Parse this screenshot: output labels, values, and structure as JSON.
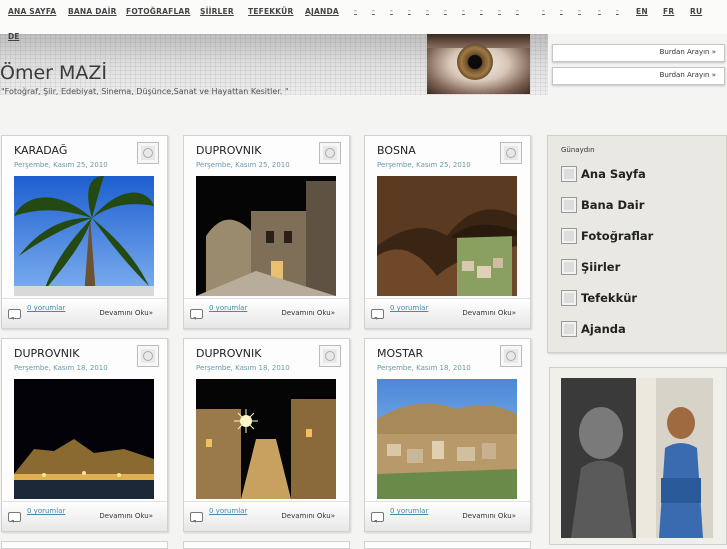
{
  "nav": {
    "items": [
      "ANA SAYFA",
      "BANA DAİR",
      "FOTOĞRAFLAR",
      "ŞİİRLER",
      "TEFEKKÜR",
      "AJANDA"
    ],
    "dash": "-",
    "langs": [
      "EN",
      "FR",
      "RU"
    ],
    "lang_de": "DE"
  },
  "header": {
    "title": "Ömer MAZİ",
    "tagline": "\"Fotoğraf, Şiir, Edebiyat, Sinema, Düşünce,Sanat ve Hayattan Kesitler. \""
  },
  "call_buttons": [
    "Burdan Arayın »",
    "Burdan Arayın »"
  ],
  "posts": [
    {
      "title": "KARADAĞ",
      "date": "Perşembe, Kasım 25, 2010",
      "comments": "0 yorumlar",
      "read_more": "Devamını Oku»"
    },
    {
      "title": "DUPROVNIK",
      "date": "Perşembe, Kasım 25, 2010",
      "comments": "0 yorumlar",
      "read_more": "Devamını Oku»"
    },
    {
      "title": "BOSNA",
      "date": "Perşembe, Kasım 25, 2010",
      "comments": "0 yorumlar",
      "read_more": "Devamını Oku»"
    },
    {
      "title": "DUPROVNIK",
      "date": "Perşembe, Kasım 18, 2010",
      "comments": "0 yorumlar",
      "read_more": "Devamını Oku»"
    },
    {
      "title": "DUPROVNIK",
      "date": "Perşembe, Kasım 18, 2010",
      "comments": "0 yorumlar",
      "read_more": "Devamını Oku»"
    },
    {
      "title": "MOSTAR",
      "date": "Perşembe, Kasım 18, 2010",
      "comments": "0 yorumlar",
      "read_more": "Devamını Oku»"
    }
  ],
  "sidebar": {
    "greeting": "Günaydın",
    "items": [
      "Ana Sayfa",
      "Bana Dair",
      "Fotoğraflar",
      "Şiirler",
      "Tefekkür",
      "Ajanda"
    ]
  }
}
